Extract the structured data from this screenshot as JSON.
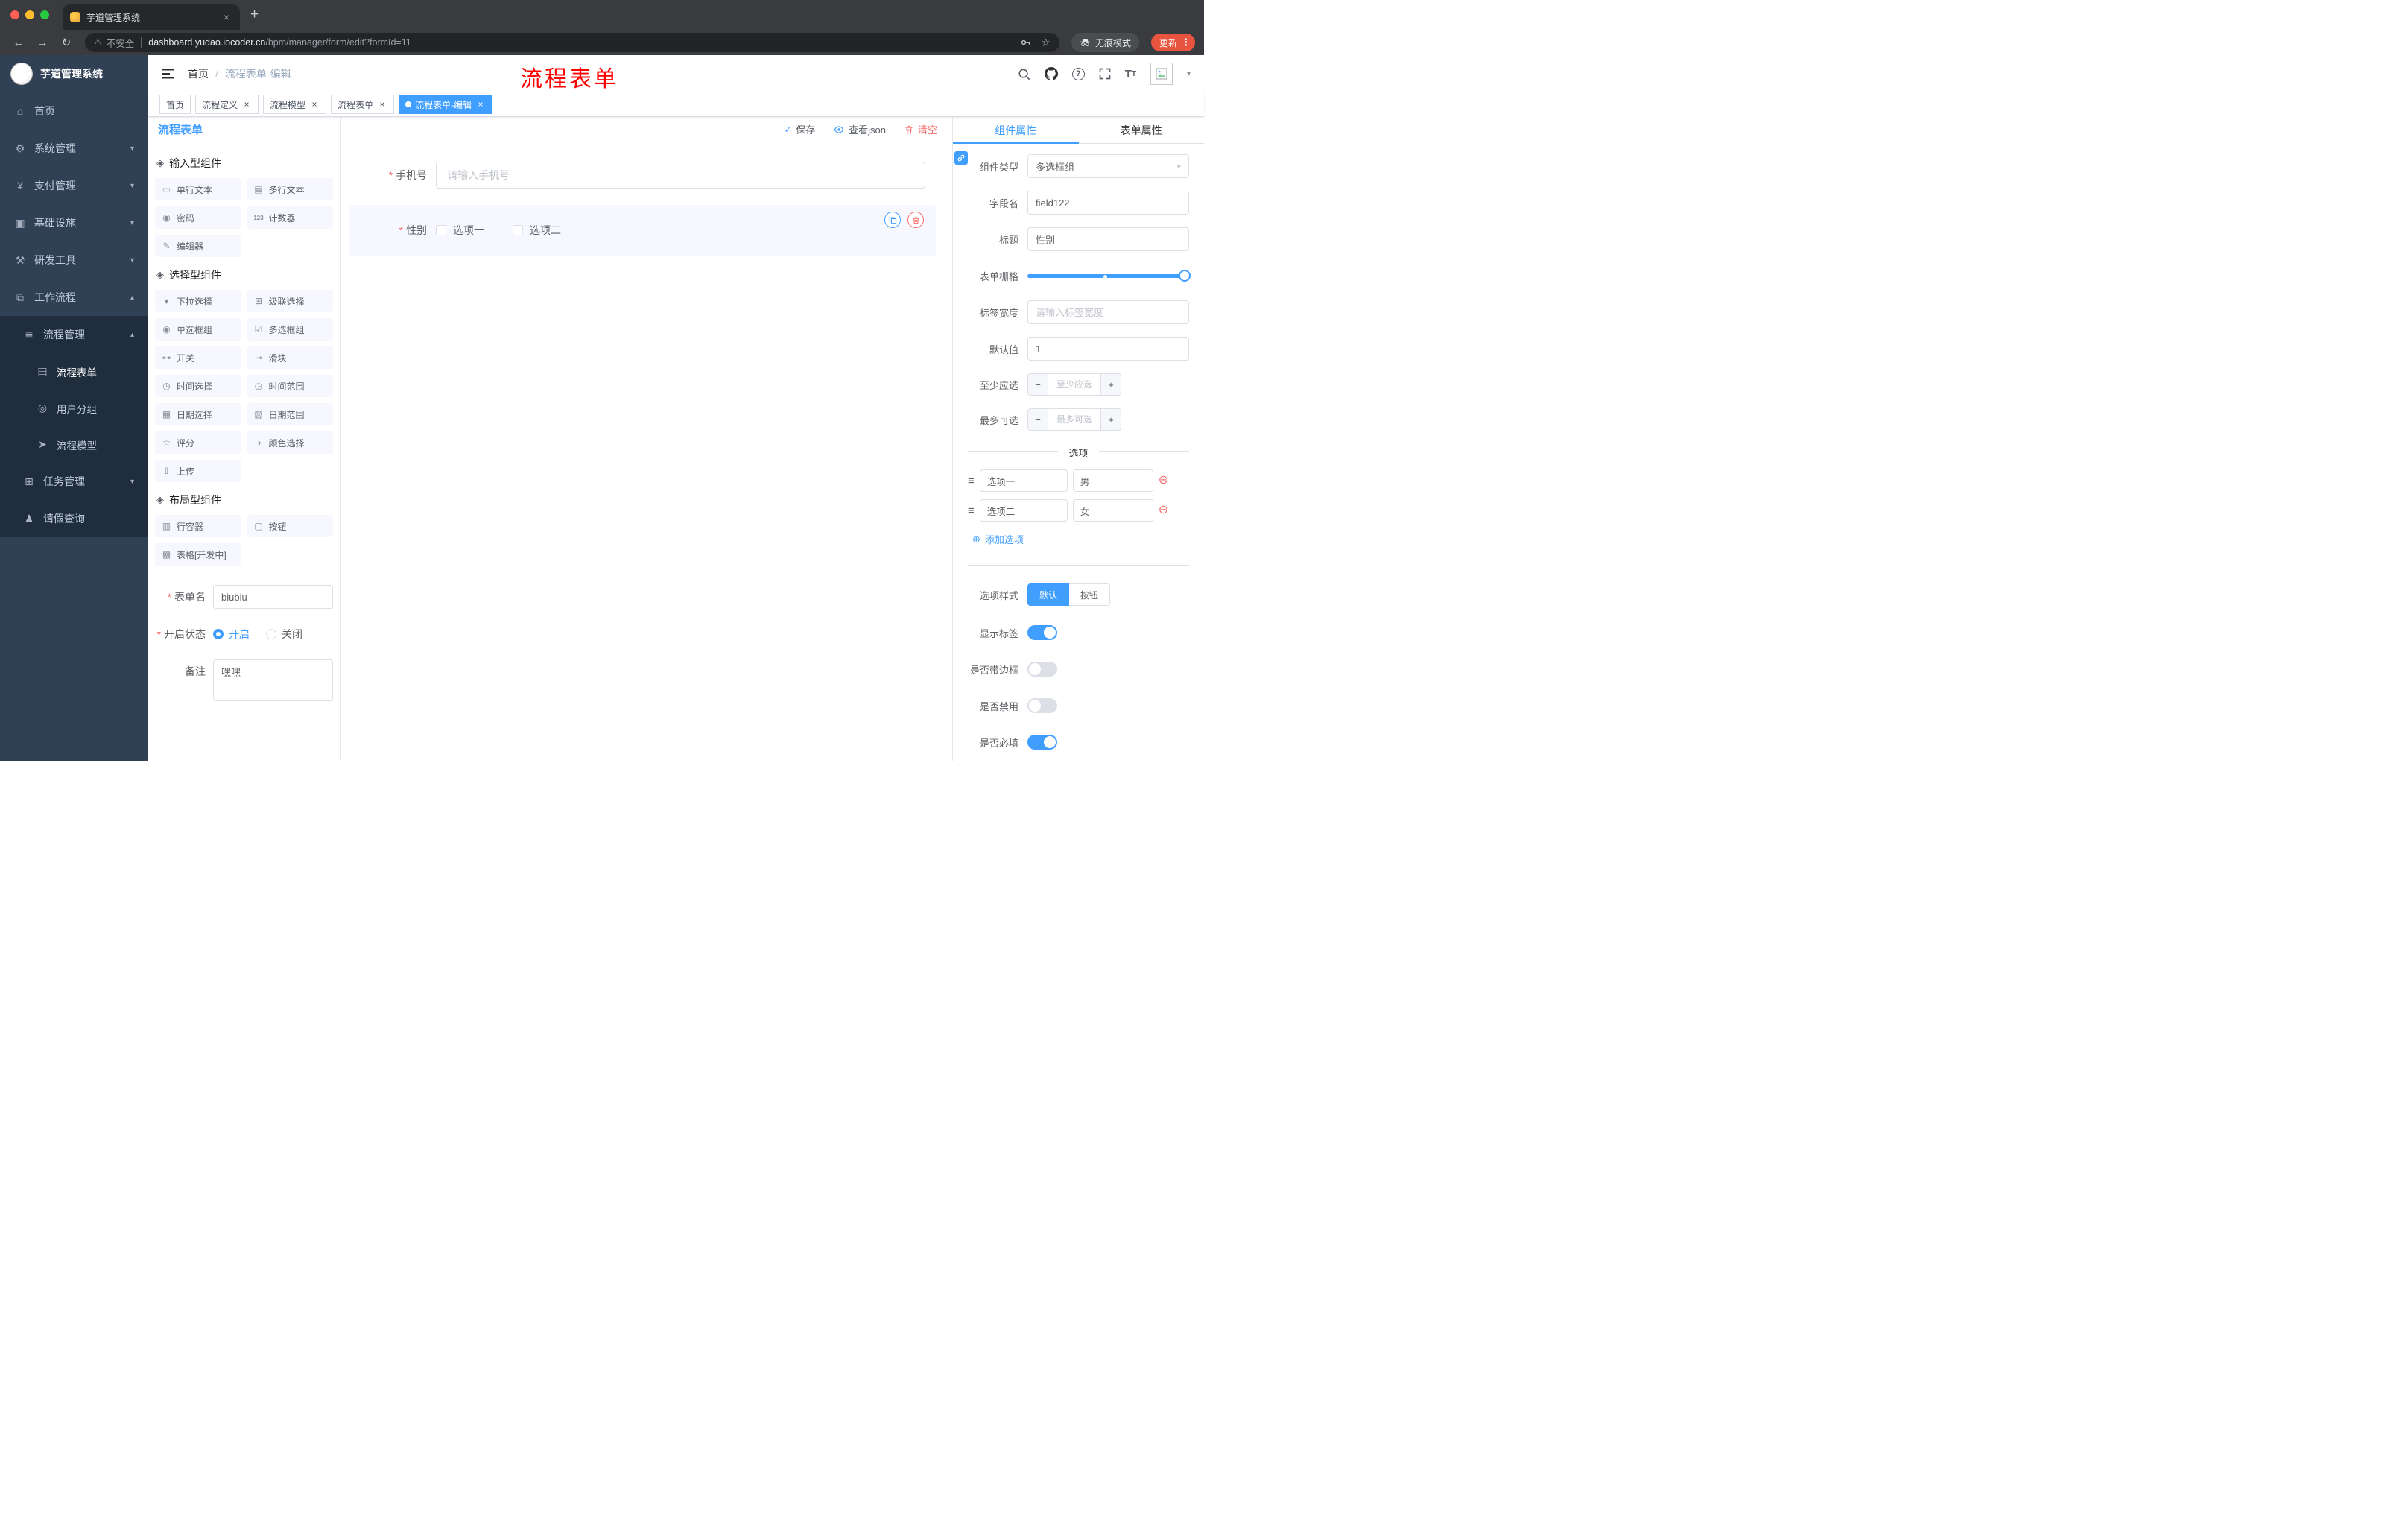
{
  "browser": {
    "tab_title": "芋道管理系统",
    "url_security": "不安全",
    "url_host": "dashboard.yudao.iocoder.cn",
    "url_path": "/bpm/manager/form/edit?formId=11",
    "incognito_label": "无痕模式",
    "update_label": "更新"
  },
  "sidebar": {
    "logo_title": "芋道管理系统",
    "items": [
      {
        "name": "home",
        "label": "首页",
        "icon": "home-icon",
        "level": 1
      },
      {
        "name": "system-management",
        "label": "系统管理",
        "icon": "gear-icon",
        "level": 1,
        "chevron": "down"
      },
      {
        "name": "payment-management",
        "label": "支付管理",
        "icon": "yen-icon",
        "level": 1,
        "chevron": "down"
      },
      {
        "name": "infrastructure",
        "label": "基础设施",
        "icon": "infra-icon",
        "level": 1,
        "chevron": "down"
      },
      {
        "name": "dev-tools",
        "label": "研发工具",
        "icon": "tools-icon",
        "level": 1,
        "chevron": "down"
      },
      {
        "name": "workflow",
        "label": "工作流程",
        "icon": "workflow-icon",
        "level": 1,
        "chevron": "up"
      },
      {
        "name": "process-management",
        "label": "流程管理",
        "icon": "process-icon",
        "level": 2,
        "chevron": "up"
      },
      {
        "name": "process-form",
        "label": "流程表单",
        "icon": "form-icon",
        "level": 3,
        "active": true
      },
      {
        "name": "user-group",
        "label": "用户分组",
        "icon": "group-icon",
        "level": 3
      },
      {
        "name": "process-model",
        "label": "流程模型",
        "icon": "model-icon",
        "level": 3
      },
      {
        "name": "task-management",
        "label": "任务管理",
        "icon": "task-icon",
        "level": 2,
        "chevron": "down"
      },
      {
        "name": "leave-query",
        "label": "请假查询",
        "icon": "leave-icon",
        "level": 2
      }
    ]
  },
  "header": {
    "breadcrumb": [
      "首页",
      "流程表单-编辑"
    ],
    "annotation": "流程表单"
  },
  "tags": [
    {
      "name": "home",
      "label": "首页",
      "closable": false,
      "active": false
    },
    {
      "name": "process-definition",
      "label": "流程定义",
      "closable": true,
      "active": false
    },
    {
      "name": "process-model",
      "label": "流程模型",
      "closable": true,
      "active": false
    },
    {
      "name": "process-form",
      "label": "流程表单",
      "closable": true,
      "active": false
    },
    {
      "name": "process-form-edit",
      "label": "流程表单-编辑",
      "closable": true,
      "active": true
    }
  ],
  "designer": {
    "title": "流程表单",
    "actions": {
      "save": "保存",
      "view_json": "查看json",
      "clear": "清空"
    },
    "groups": [
      {
        "name": "input-components",
        "title": "输入型组件",
        "icon": "component-section-icon",
        "items": [
          {
            "name": "single-line-text",
            "label": "单行文本",
            "icon": "input-icon"
          },
          {
            "name": "multi-line-text",
            "label": "多行文本",
            "icon": "textarea-icon"
          },
          {
            "name": "password",
            "label": "密码",
            "icon": "password-icon"
          },
          {
            "name": "counter",
            "label": "计数器",
            "icon": "counter-icon"
          },
          {
            "name": "editor",
            "label": "编辑器",
            "icon": "editor-icon"
          }
        ]
      },
      {
        "name": "select-components",
        "title": "选择型组件",
        "icon": "component-section-icon",
        "items": [
          {
            "name": "select",
            "label": "下拉选择",
            "icon": "select-icon"
          },
          {
            "name": "cascader",
            "label": "级联选择",
            "icon": "cascader-icon"
          },
          {
            "name": "radio-group",
            "label": "单选框组",
            "icon": "radio-icon"
          },
          {
            "name": "checkbox-group",
            "label": "多选框组",
            "icon": "checkbox-icon"
          },
          {
            "name": "switch",
            "label": "开关",
            "icon": "switch-icon"
          },
          {
            "name": "slider",
            "label": "滑块",
            "icon": "slider-icon"
          },
          {
            "name": "time-picker",
            "label": "时间选择",
            "icon": "time-icon"
          },
          {
            "name": "time-range",
            "label": "时间范围",
            "icon": "time-range-icon"
          },
          {
            "name": "date-picker",
            "label": "日期选择",
            "icon": "date-icon"
          },
          {
            "name": "date-range",
            "label": "日期范围",
            "icon": "date-range-icon"
          },
          {
            "name": "rate",
            "label": "评分",
            "icon": "rate-icon"
          },
          {
            "name": "color-picker",
            "label": "颜色选择",
            "icon": "color-icon"
          },
          {
            "name": "upload",
            "label": "上传",
            "icon": "upload-icon"
          }
        ]
      },
      {
        "name": "layout-components",
        "title": "布局型组件",
        "icon": "component-section-icon",
        "items": [
          {
            "name": "row-container",
            "label": "行容器",
            "icon": "row-icon"
          },
          {
            "name": "button",
            "label": "按钮",
            "icon": "button-icon"
          },
          {
            "name": "table",
            "label": "表格[开发中]",
            "icon": "table-icon"
          }
        ]
      }
    ],
    "form": {
      "name_label": "表单名",
      "name_value": "biubiu",
      "status_label": "开启状态",
      "status_options": [
        "开启",
        "关闭"
      ],
      "status_selected": "开启",
      "remark_label": "备注",
      "remark_value": "嘿嘿"
    }
  },
  "canvas": {
    "phone_label": "手机号",
    "phone_placeholder": "请输入手机号",
    "gender_label": "性别",
    "gender_options": [
      "选项一",
      "选项二"
    ]
  },
  "properties": {
    "tabs": [
      "组件属性",
      "表单属性"
    ],
    "component_type_label": "组件类型",
    "component_type_value": "多选框组",
    "field_name_label": "字段名",
    "field_name_value": "field122",
    "title_label": "标题",
    "title_value": "性别",
    "grid_label": "表单栅格",
    "label_width_label": "标签宽度",
    "label_width_placeholder": "请输入标签宽度",
    "default_label": "默认值",
    "default_value": "1",
    "min_label": "至少应选",
    "min_placeholder": "至少应选",
    "max_label": "最多可选",
    "max_placeholder": "最多可选",
    "options_divider": "选项",
    "options": [
      {
        "label": "选项一",
        "value": "男"
      },
      {
        "label": "选项二",
        "value": "女"
      }
    ],
    "add_option": "添加选项",
    "style_label": "选项样式",
    "style_options": [
      "默认",
      "按钮"
    ],
    "style_selected": "默认",
    "switches": [
      {
        "name": "show-label",
        "label": "显示标签",
        "on": true
      },
      {
        "name": "with-border",
        "label": "是否带边框",
        "on": false
      },
      {
        "name": "disabled",
        "label": "是否禁用",
        "on": false
      },
      {
        "name": "required",
        "label": "是否必填",
        "on": true
      }
    ],
    "colors": {
      "primary": "#409eff",
      "danger": "#f56c6c"
    }
  }
}
